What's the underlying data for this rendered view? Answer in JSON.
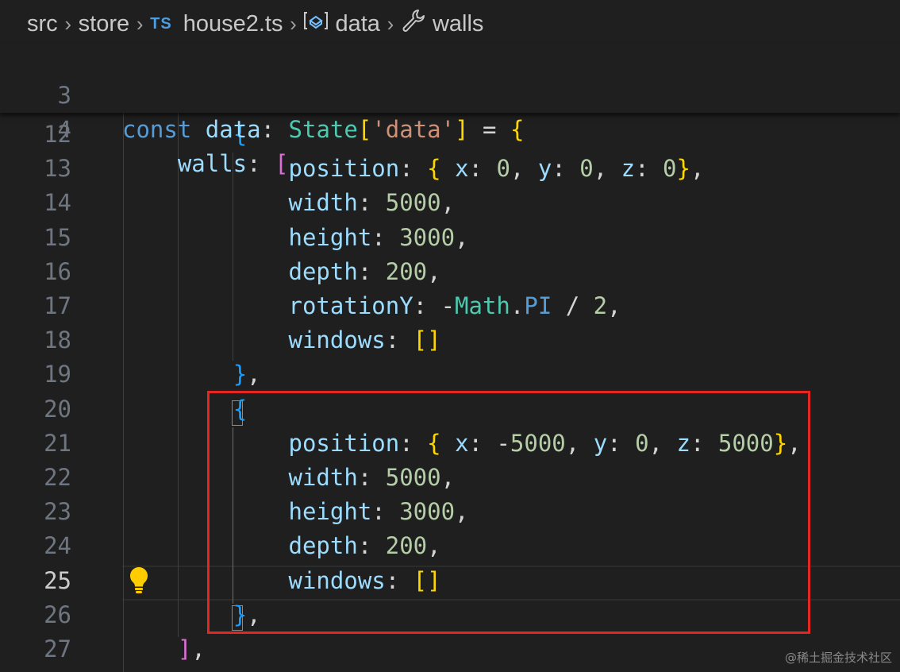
{
  "breadcrumb": {
    "items": [
      "src",
      "store",
      "house2.ts",
      "data",
      "walls"
    ],
    "ts_badge": "TS",
    "file_icon": "typescript-file-icon",
    "variable_icon": "variable-icon",
    "property_icon": "wrench-icon"
  },
  "sticky_lines": [
    {
      "num": "3",
      "tokens": [
        [
          "kw",
          "const"
        ],
        [
          "op",
          " "
        ],
        [
          "var",
          "data"
        ],
        [
          "op",
          ": "
        ],
        [
          "ty",
          "State"
        ],
        [
          "b1",
          "["
        ],
        [
          "str",
          "'data'"
        ],
        [
          "b1",
          "]"
        ],
        [
          "op",
          " = "
        ],
        [
          "b1",
          "{"
        ]
      ]
    },
    {
      "num": "4",
      "tokens": [
        [
          "op",
          "    "
        ],
        [
          "var",
          "walls"
        ],
        [
          "op",
          ": "
        ],
        [
          "b2",
          "["
        ]
      ]
    }
  ],
  "lines": [
    {
      "num": "12",
      "tokens": [
        [
          "op",
          "        "
        ],
        [
          "b3",
          "{"
        ]
      ]
    },
    {
      "num": "13",
      "tokens": [
        [
          "op",
          "            "
        ],
        [
          "var",
          "position"
        ],
        [
          "op",
          ": "
        ],
        [
          "b1",
          "{"
        ],
        [
          "op",
          " "
        ],
        [
          "var",
          "x"
        ],
        [
          "op",
          ": "
        ],
        [
          "num",
          "0"
        ],
        [
          "op",
          ", "
        ],
        [
          "var",
          "y"
        ],
        [
          "op",
          ": "
        ],
        [
          "num",
          "0"
        ],
        [
          "op",
          ", "
        ],
        [
          "var",
          "z"
        ],
        [
          "op",
          ": "
        ],
        [
          "num",
          "0"
        ],
        [
          "b1",
          "}"
        ],
        [
          "op",
          ","
        ]
      ]
    },
    {
      "num": "14",
      "tokens": [
        [
          "op",
          "            "
        ],
        [
          "var",
          "width"
        ],
        [
          "op",
          ": "
        ],
        [
          "num",
          "5000"
        ],
        [
          "op",
          ","
        ]
      ]
    },
    {
      "num": "15",
      "tokens": [
        [
          "op",
          "            "
        ],
        [
          "var",
          "height"
        ],
        [
          "op",
          ": "
        ],
        [
          "num",
          "3000"
        ],
        [
          "op",
          ","
        ]
      ]
    },
    {
      "num": "16",
      "tokens": [
        [
          "op",
          "            "
        ],
        [
          "var",
          "depth"
        ],
        [
          "op",
          ": "
        ],
        [
          "num",
          "200"
        ],
        [
          "op",
          ","
        ]
      ]
    },
    {
      "num": "17",
      "tokens": [
        [
          "op",
          "            "
        ],
        [
          "var",
          "rotationY"
        ],
        [
          "op",
          ": -"
        ],
        [
          "ty",
          "Math"
        ],
        [
          "op",
          "."
        ],
        [
          "kw",
          "PI"
        ],
        [
          "op",
          " / "
        ],
        [
          "num",
          "2"
        ],
        [
          "op",
          ","
        ]
      ]
    },
    {
      "num": "18",
      "tokens": [
        [
          "op",
          "            "
        ],
        [
          "var",
          "windows"
        ],
        [
          "op",
          ": "
        ],
        [
          "b1",
          "[]"
        ]
      ]
    },
    {
      "num": "19",
      "tokens": [
        [
          "op",
          "        "
        ],
        [
          "b3",
          "}"
        ],
        [
          "op",
          ","
        ]
      ]
    },
    {
      "num": "20",
      "tokens": [
        [
          "op",
          "        "
        ],
        [
          "b3",
          "{"
        ]
      ]
    },
    {
      "num": "21",
      "tokens": [
        [
          "op",
          "            "
        ],
        [
          "var",
          "position"
        ],
        [
          "op",
          ": "
        ],
        [
          "b1",
          "{"
        ],
        [
          "op",
          " "
        ],
        [
          "var",
          "x"
        ],
        [
          "op",
          ": -"
        ],
        [
          "num",
          "5000"
        ],
        [
          "op",
          ", "
        ],
        [
          "var",
          "y"
        ],
        [
          "op",
          ": "
        ],
        [
          "num",
          "0"
        ],
        [
          "op",
          ", "
        ],
        [
          "var",
          "z"
        ],
        [
          "op",
          ": "
        ],
        [
          "num",
          "5000"
        ],
        [
          "b1",
          "}"
        ],
        [
          "op",
          ","
        ]
      ]
    },
    {
      "num": "22",
      "tokens": [
        [
          "op",
          "            "
        ],
        [
          "var",
          "width"
        ],
        [
          "op",
          ": "
        ],
        [
          "num",
          "5000"
        ],
        [
          "op",
          ","
        ]
      ]
    },
    {
      "num": "23",
      "tokens": [
        [
          "op",
          "            "
        ],
        [
          "var",
          "height"
        ],
        [
          "op",
          ": "
        ],
        [
          "num",
          "3000"
        ],
        [
          "op",
          ","
        ]
      ]
    },
    {
      "num": "24",
      "tokens": [
        [
          "op",
          "            "
        ],
        [
          "var",
          "depth"
        ],
        [
          "op",
          ": "
        ],
        [
          "num",
          "200"
        ],
        [
          "op",
          ","
        ]
      ]
    },
    {
      "num": "25",
      "active": true,
      "tokens": [
        [
          "op",
          "            "
        ],
        [
          "var",
          "windows"
        ],
        [
          "op",
          ": "
        ],
        [
          "b1",
          "[]"
        ]
      ]
    },
    {
      "num": "26",
      "tokens": [
        [
          "op",
          "        "
        ],
        [
          "b3",
          "}"
        ],
        [
          "op",
          ","
        ]
      ]
    },
    {
      "num": "27",
      "tokens": [
        [
          "op",
          "    "
        ],
        [
          "b2",
          "]"
        ],
        [
          "op",
          ","
        ]
      ]
    }
  ],
  "watermark": "@稀土掘金技术社区",
  "colors": {
    "highlight_box": "#e5251f",
    "background": "#1f1f1f"
  }
}
